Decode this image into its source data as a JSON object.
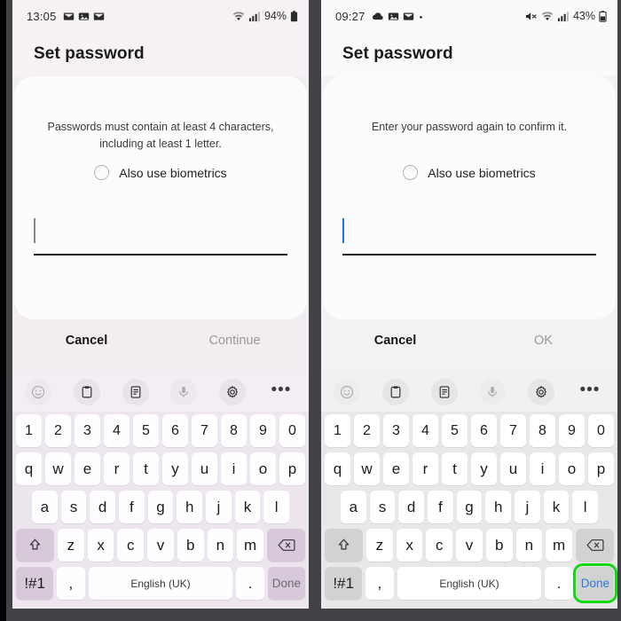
{
  "screen": {
    "title": "Set password",
    "frame_color": "#414245",
    "accent_highlight": "#12d912"
  },
  "panels": [
    {
      "id": "left",
      "theme": "purple",
      "status": {
        "time": "13:05",
        "left_icons": [
          "mail-icon",
          "photos-icon",
          "mail-icon"
        ],
        "right_icons": [
          "wifi-icon",
          "signal-icon"
        ],
        "battery": "94%"
      },
      "title": "Set password",
      "card": {
        "message": "Passwords must contain at least 4 characters, including at least 1 letter.",
        "biometrics_label": "Also use biometrics",
        "biometrics_checked": false,
        "password_value": "",
        "caret_color": "#8d8885"
      },
      "actions": {
        "cancel": "Cancel",
        "confirm": "Continue",
        "confirm_enabled": false
      },
      "keyboard": {
        "toolbar": [
          "emoji-icon",
          "clipboard-icon",
          "text-extract-icon",
          "microphone-icon",
          "settings-gear-icon",
          "more-options-icon"
        ],
        "row_numbers": [
          "1",
          "2",
          "3",
          "4",
          "5",
          "6",
          "7",
          "8",
          "9",
          "0"
        ],
        "row_top": [
          "q",
          "w",
          "e",
          "r",
          "t",
          "y",
          "u",
          "i",
          "o",
          "p"
        ],
        "row_home": [
          "a",
          "s",
          "d",
          "f",
          "g",
          "h",
          "j",
          "k",
          "l"
        ],
        "row_bottom": [
          "z",
          "x",
          "c",
          "v",
          "b",
          "n",
          "m"
        ],
        "shift_label": "shift-icon",
        "backspace_label": "backspace-icon",
        "symbols_label": "!#1",
        "comma_label": ",",
        "space_label": "English (UK)",
        "period_label": ".",
        "done_label": "Done",
        "done_highlighted": false
      }
    },
    {
      "id": "right",
      "theme": "grey",
      "status": {
        "time": "09:27",
        "left_icons": [
          "cloud-icon",
          "photos-icon",
          "mail-icon",
          "dot-icon"
        ],
        "right_icons": [
          "mute-icon",
          "wifi-icon",
          "signal-icon"
        ],
        "battery": "43%"
      },
      "title": "Set password",
      "card": {
        "message": "Enter your password again to confirm it.",
        "biometrics_label": "Also use biometrics",
        "biometrics_checked": false,
        "password_value": "",
        "caret_color": "#1a73e8"
      },
      "actions": {
        "cancel": "Cancel",
        "confirm": "OK",
        "confirm_enabled": false
      },
      "keyboard": {
        "toolbar": [
          "emoji-icon",
          "clipboard-icon",
          "text-extract-icon",
          "microphone-icon",
          "settings-gear-icon",
          "more-options-icon"
        ],
        "row_numbers": [
          "1",
          "2",
          "3",
          "4",
          "5",
          "6",
          "7",
          "8",
          "9",
          "0"
        ],
        "row_top": [
          "q",
          "w",
          "e",
          "r",
          "t",
          "y",
          "u",
          "i",
          "o",
          "p"
        ],
        "row_home": [
          "a",
          "s",
          "d",
          "f",
          "g",
          "h",
          "j",
          "k",
          "l"
        ],
        "row_bottom": [
          "z",
          "x",
          "c",
          "v",
          "b",
          "n",
          "m"
        ],
        "shift_label": "shift-icon",
        "backspace_label": "backspace-icon",
        "symbols_label": "!#1",
        "comma_label": ",",
        "space_label": "English (UK)",
        "period_label": ".",
        "done_label": "Done",
        "done_highlighted": true
      }
    }
  ]
}
